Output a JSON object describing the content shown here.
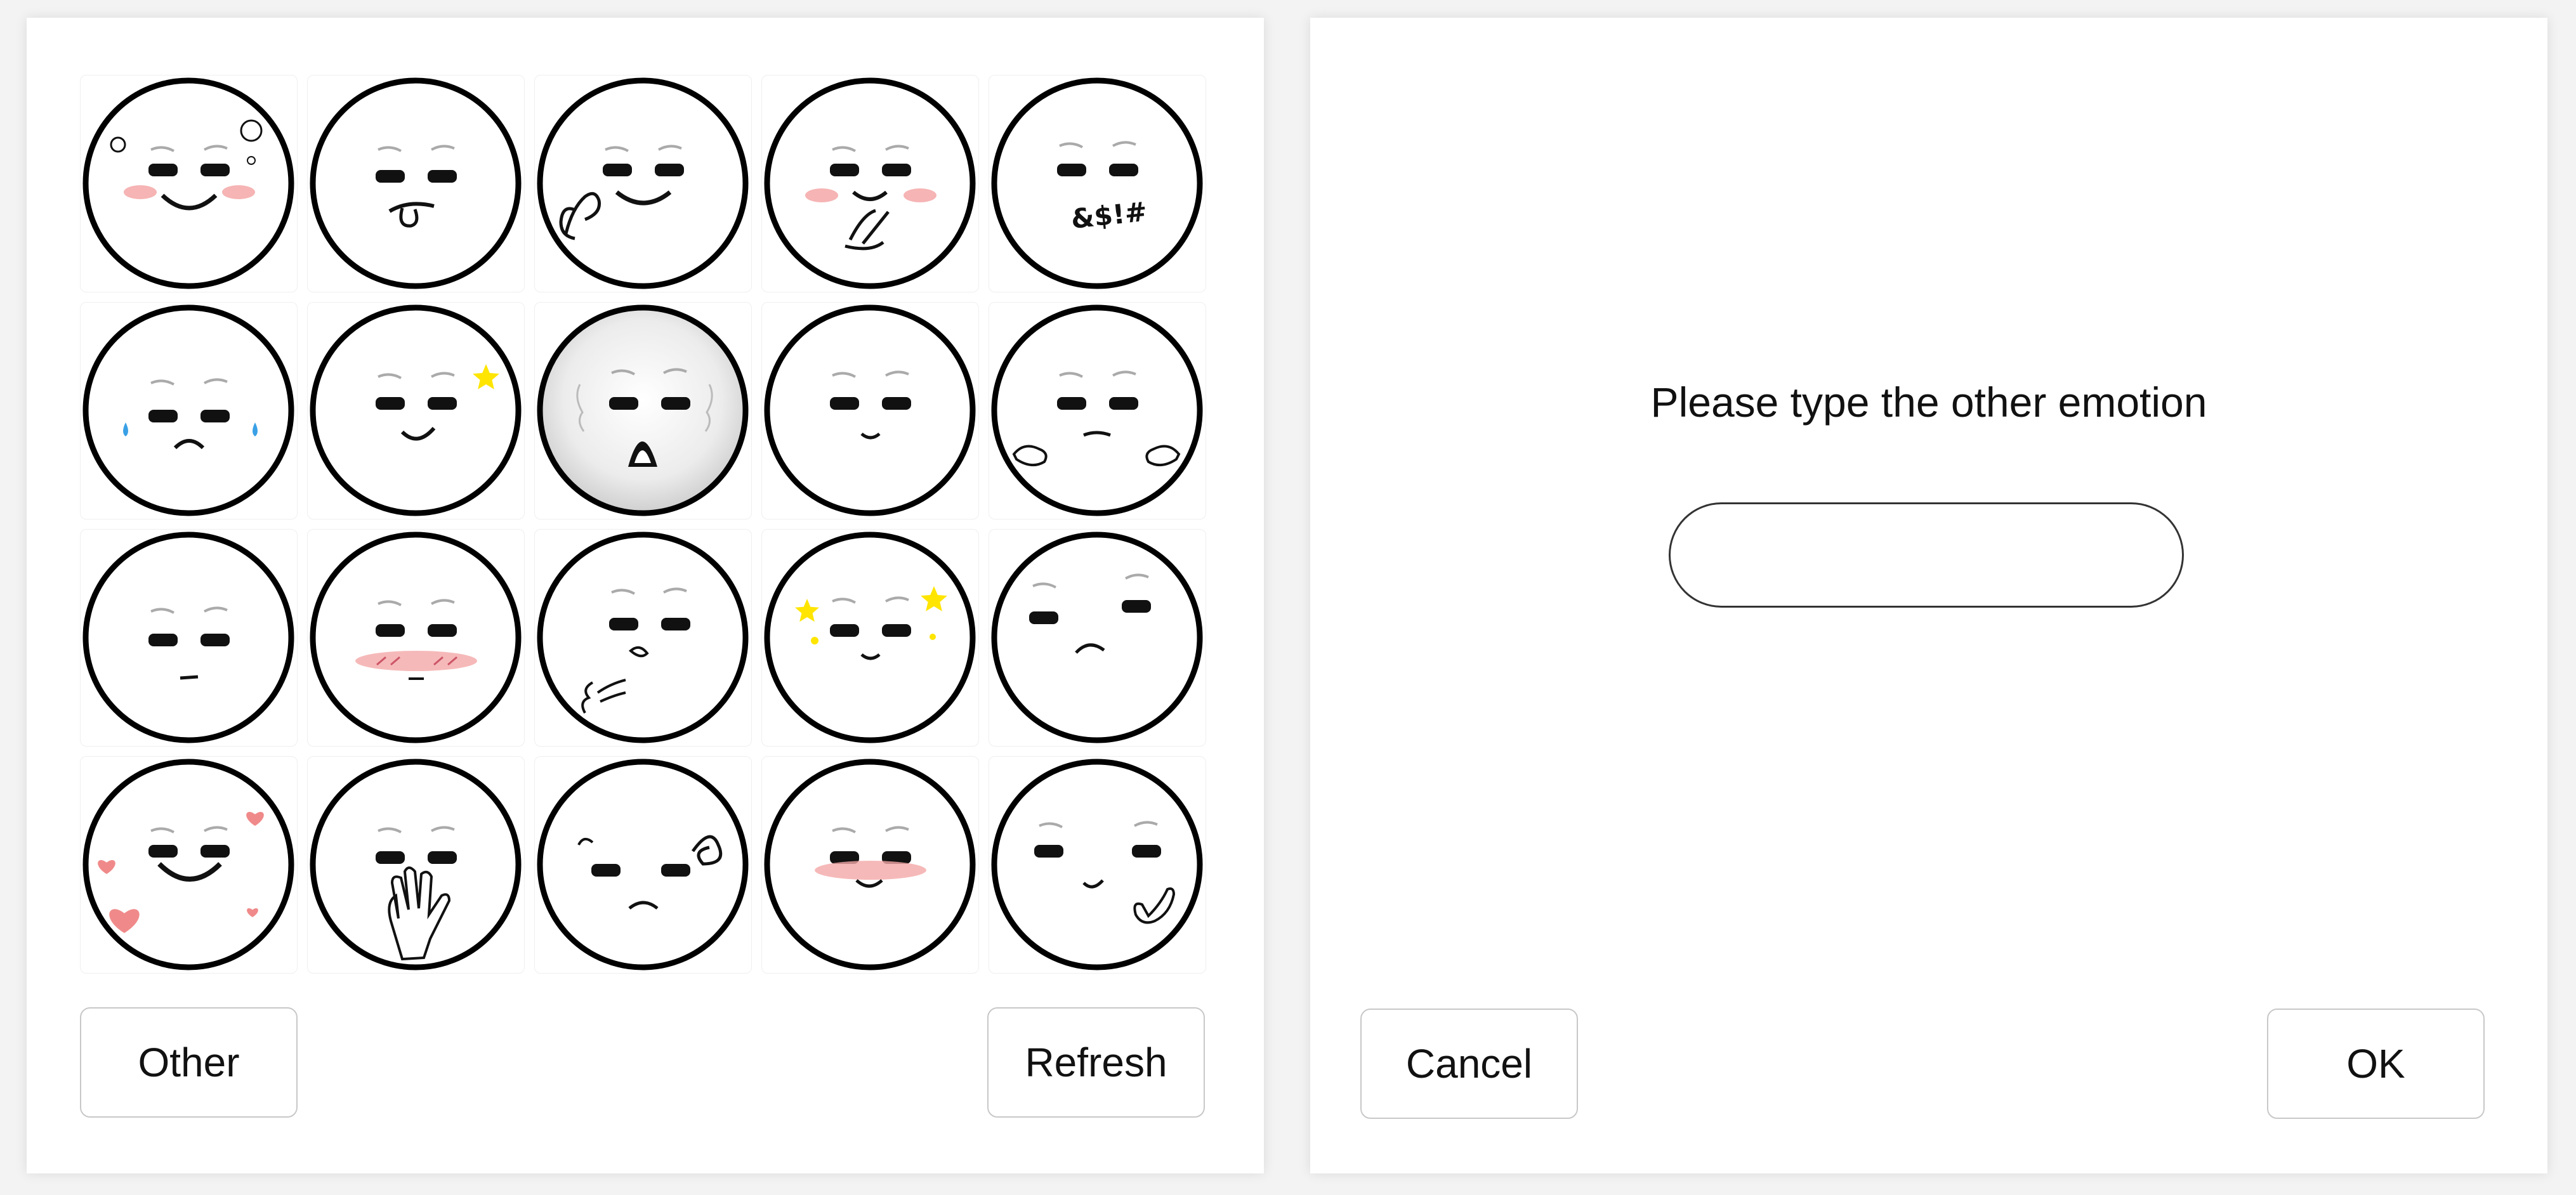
{
  "picker": {
    "emotions": [
      {
        "icon": "happy-flowers-icon"
      },
      {
        "icon": "tongue-out-icon"
      },
      {
        "icon": "ok-hand-smile-icon"
      },
      {
        "icon": "blushing-peace-icon"
      },
      {
        "icon": "cursing-symbols-icon"
      },
      {
        "icon": "crying-icon"
      },
      {
        "icon": "wink-star-icon"
      },
      {
        "icon": "shocked-icon",
        "selected": true
      },
      {
        "icon": "slight-smile-icon"
      },
      {
        "icon": "shrug-icon"
      },
      {
        "icon": "neutral-icon"
      },
      {
        "icon": "embarrassed-blush-icon"
      },
      {
        "icon": "sigh-icon"
      },
      {
        "icon": "starstruck-icon"
      },
      {
        "icon": "confused-icon"
      },
      {
        "icon": "in-love-hearts-icon"
      },
      {
        "icon": "hand-over-mouth-icon"
      },
      {
        "icon": "frustrated-icon"
      },
      {
        "icon": "shy-blush-icon"
      },
      {
        "icon": "cool-shaka-icon"
      }
    ],
    "other_label": "Other",
    "refresh_label": "Refresh"
  },
  "dialog": {
    "prompt": "Please type the other emotion",
    "input_value": "",
    "input_placeholder": "",
    "cancel_label": "Cancel",
    "ok_label": "OK"
  },
  "colors": {
    "blush": "#f4a7a7",
    "tear": "#3aa0e6",
    "star": "#ffe500",
    "heart": "#f08a8a"
  }
}
